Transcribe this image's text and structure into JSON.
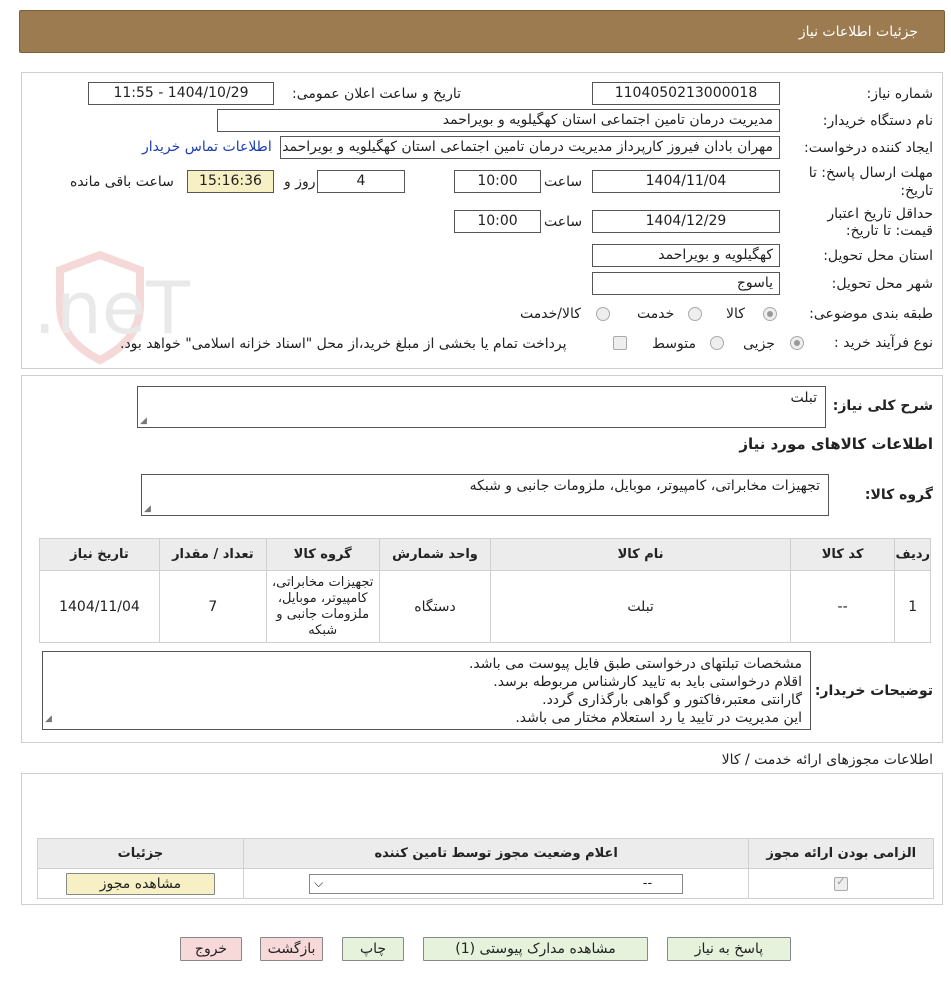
{
  "header": {
    "title": "جزئیات اطلاعات نیاز"
  },
  "form": {
    "need_number_label": "شماره نیاز:",
    "need_number": "1104050213000018",
    "announce_label": "تاریخ و ساعت اعلان عمومی:",
    "announce_value": "1404/10/29 - 11:55",
    "buyer_org_label": "نام دستگاه خریدار:",
    "buyer_org": "مدیریت درمان تامین اجتماعی استان کهگیلویه و بویراحمد",
    "creator_label": "ایجاد کننده درخواست:",
    "creator": "مهران بادان فیروز کارپرداز مدیریت درمان تامین اجتماعی استان کهگیلویه و بویراحمد",
    "contact_link": "اطلاعات تماس خریدار",
    "deadline_label_1": "مهلت ارسال پاسخ: تا",
    "deadline_label_2": "تاریخ:",
    "deadline_date": "1404/11/04",
    "time_label": "ساعت",
    "deadline_time": "10:00",
    "days_value": "4",
    "days_label": "روز و",
    "remaining_time": "15:16:36",
    "remaining_label": "ساعت باقی مانده",
    "validity_label_1": "حداقل تاریخ اعتبار",
    "validity_label_2": "قیمت: تا تاریخ:",
    "validity_date": "1404/12/29",
    "validity_time": "10:00",
    "province_label": "استان محل تحویل:",
    "province": "کهگیلویه و بویراحمد",
    "city_label": "شهر محل تحویل:",
    "city": "یاسوج",
    "category_label": "طبقه بندی موضوعی:",
    "category_options": [
      "کالا",
      "خدمت",
      "کالا/خدمت"
    ],
    "process_label": "نوع فرآیند خرید :",
    "process_options": [
      "جزیی",
      "متوسط"
    ],
    "payment_note": "پرداخت تمام یا بخشی از مبلغ خرید،از محل \"اسناد خزانه اسلامی\" خواهد بود."
  },
  "summary": {
    "label": "شرح کلی نیاز:",
    "value": "تبلت",
    "goods_info_title": "اطلاعات کالاهای مورد نیاز",
    "goods_group_label": "گروه کالا:",
    "goods_group": "تجهیزات مخابراتی، کامپیوتر، موبایل، ملزومات جانبی و شبکه"
  },
  "items_table": {
    "headers": [
      "ردیف",
      "کد کالا",
      "نام کالا",
      "واحد شمارش",
      "گروه کالا",
      "تعداد / مقدار",
      "تاریخ نیاز"
    ],
    "rows": [
      [
        "1",
        "--",
        "تبلت",
        "دستگاه",
        "تجهیزات مخابراتی، کامپیوتر، موبایل، ملزومات جانبی و شبکه",
        "7",
        "1404/11/04"
      ]
    ]
  },
  "buyer_notes": {
    "label": "توضیحات خریدار:",
    "lines": [
      "مشخصات تبلتهای درخواستی طبق فایل پیوست می باشد.",
      "اقلام درخواستی باید به تایید کارشناس مربوطه برسد.",
      "گارانتی معتبر،فاکتور و گواهی بارگذاری گردد.",
      "این مدیریت در تایید یا رد استعلام مختار می باشد."
    ]
  },
  "permits": {
    "title": "اطلاعات مجوزهای ارائه خدمت / کالا",
    "headers": [
      "الزامی بودن ارائه مجوز",
      "اعلام وضعیت مجوز توسط تامین کننده",
      "جزئیات"
    ],
    "select_value": "--",
    "view_button": "مشاهده مجوز"
  },
  "buttons": {
    "respond": "پاسخ به نیاز",
    "attachments": "مشاهده مدارک پیوستی (1)",
    "print": "چاپ",
    "back": "بازگشت",
    "exit": "خروج"
  },
  "watermark": {
    "text": "AriaTender.neT"
  },
  "colors": {
    "header_bg": "#9b7b4f",
    "button_green": "#e6f2dc",
    "button_pink": "#f8d9d9",
    "remaining_bg": "#f6f0c4"
  }
}
